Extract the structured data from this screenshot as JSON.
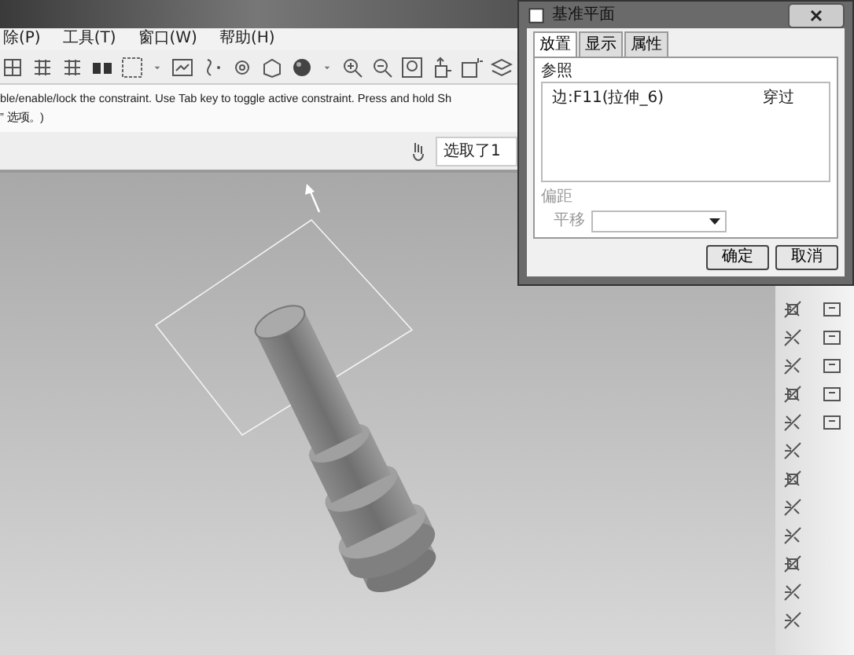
{
  "menu": [
    {
      "label": "除(P)"
    },
    {
      "label": "工具(T)"
    },
    {
      "label": "窗口(W)"
    },
    {
      "label": "帮助(H)"
    }
  ],
  "message": {
    "lines": [
      "ble/enable/lock the constraint. Use Tab key to toggle active constraint. Press and hold Sh",
      "” 选项。)"
    ]
  },
  "status": {
    "text": "选取了1"
  },
  "dialog": {
    "title": "基准平面",
    "tabs": [
      {
        "label": "放置",
        "selected": true
      },
      {
        "label": "显示",
        "selected": false
      },
      {
        "label": "属性",
        "selected": false
      }
    ],
    "references": {
      "label": "参照",
      "rows": [
        {
          "reference": "边:F11(拉伸_6)",
          "constraint": "穿过"
        }
      ]
    },
    "offset": {
      "label": "偏距",
      "field_label": "平移",
      "disabled": true
    },
    "buttons": [
      {
        "label": "确定"
      },
      {
        "label": "取消"
      }
    ]
  }
}
